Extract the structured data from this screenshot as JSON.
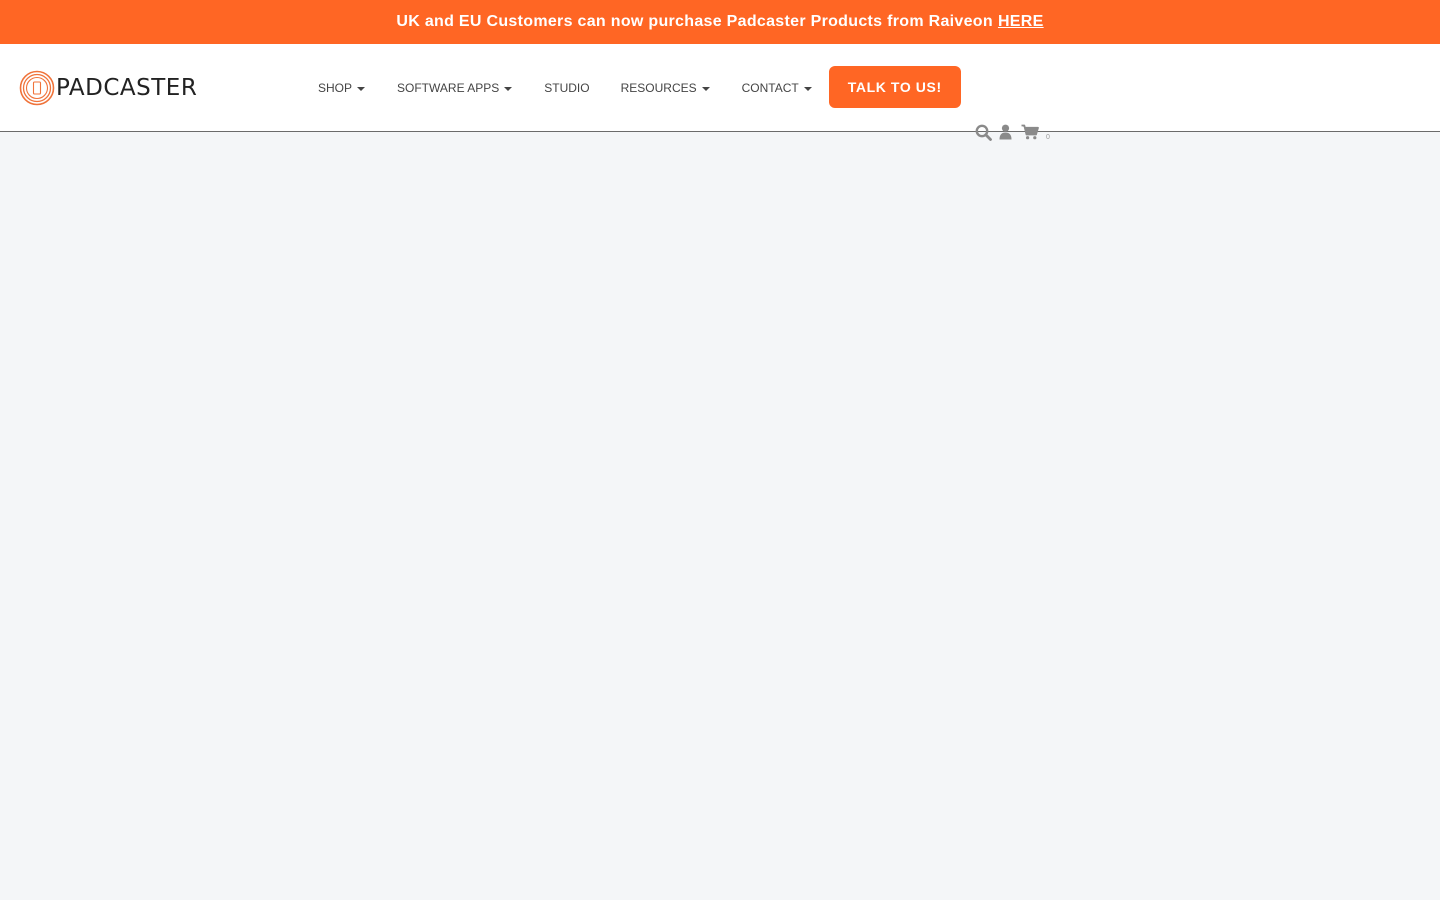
{
  "announcement": {
    "text": "UK and EU Customers can now purchase Padcaster Products from Raiveon",
    "link_text": "HERE"
  },
  "brand": {
    "name": "PADCASTER",
    "accent_color": "#ff6624"
  },
  "nav": {
    "shop": "SHOP",
    "software_apps": "SOFTWARE APPS",
    "studio": "STUDIO",
    "resources": "RESOURCES",
    "contact": "CONTACT"
  },
  "cta": {
    "label": "TALK TO US!"
  },
  "header_icons": {
    "search": "search-icon",
    "account": "user-icon",
    "cart": "cart-icon",
    "cart_count": "0"
  }
}
